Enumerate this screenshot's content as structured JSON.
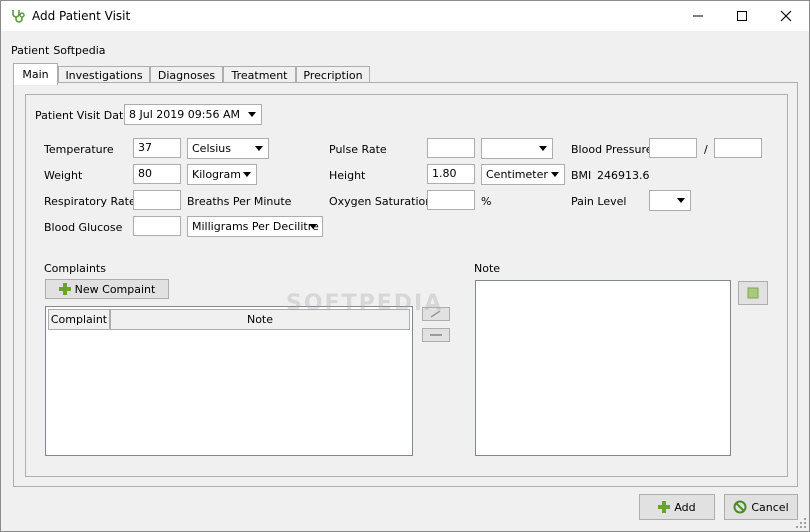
{
  "window": {
    "title": "Add Patient Visit"
  },
  "patient": {
    "label": "Patient",
    "name": "Softpedia"
  },
  "tabs": [
    {
      "label": "Main",
      "active": true
    },
    {
      "label": "Investigations"
    },
    {
      "label": "Diagnoses"
    },
    {
      "label": "Treatment"
    },
    {
      "label": "Precription"
    }
  ],
  "visit_date": {
    "label": "Patient Visit Date",
    "value": "8 Jul 2019 09:56 AM"
  },
  "vitals": {
    "temperature": {
      "label": "Temperature",
      "value": "37",
      "unit": "Celsius"
    },
    "weight": {
      "label": "Weight",
      "value": "80",
      "unit": "Kilogram"
    },
    "respiratory_rate": {
      "label": "Respiratory Rate",
      "value": "",
      "unit": "Breaths Per Minute"
    },
    "blood_glucose": {
      "label": "Blood Glucose",
      "value": "",
      "unit": "Milligrams Per Decilitre"
    },
    "pulse_rate": {
      "label": "Pulse Rate",
      "value": "",
      "unit": ""
    },
    "height": {
      "label": "Height",
      "value": "1.80",
      "unit": "Centimeter"
    },
    "oxygen_saturation": {
      "label": "Oxygen Saturation",
      "value": "",
      "unit": "%"
    },
    "blood_pressure": {
      "label": "Blood Pressure",
      "systolic": "",
      "separator": "/",
      "diastolic": ""
    },
    "bmi": {
      "label": "BMI",
      "value": "246913.6"
    },
    "pain_level": {
      "label": "Pain Level",
      "value": ""
    }
  },
  "complaints": {
    "label": "Complaints",
    "new_button": "New Compaint",
    "columns": [
      "Complaint",
      "Note"
    ]
  },
  "note": {
    "label": "Note"
  },
  "watermark": "SOFTPEDIA",
  "footer": {
    "add": "Add",
    "cancel": "Cancel"
  },
  "colors": {
    "accent_green": "#6aa32d",
    "cancel_green": "#4a8a2a"
  }
}
